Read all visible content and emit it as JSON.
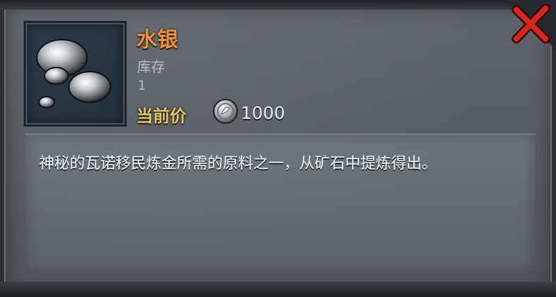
{
  "item": {
    "name": "水银",
    "stock_label": "库存",
    "stock_value": "1",
    "price_label": "当前价",
    "price_value": "1000",
    "description": "神秘的瓦诺移民炼金所需的原料之一，从矿石中提炼得出。",
    "icon": "mercury-droplets-icon"
  },
  "colors": {
    "name": "#f0913a",
    "price_label": "#e3c36a",
    "close": "#d62820"
  }
}
